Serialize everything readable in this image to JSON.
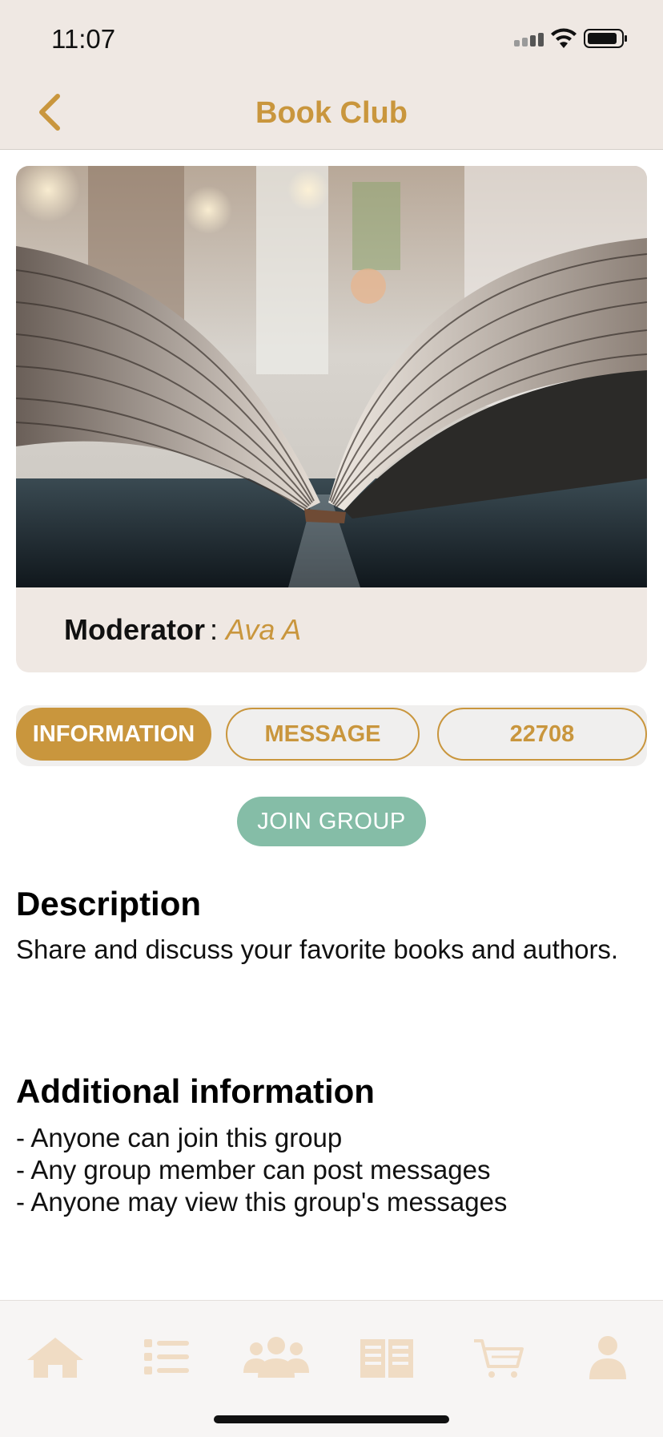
{
  "status_bar": {
    "time": "11:07"
  },
  "nav": {
    "title": "Book Club",
    "back_icon": "chevron-left-icon"
  },
  "group": {
    "moderator_label": "Moderator",
    "moderator_separator": ":",
    "moderator_name": "Ava A",
    "image": "open-book-photo"
  },
  "tabs": [
    {
      "label": "INFORMATION",
      "active": true
    },
    {
      "label": "MESSAGE",
      "active": false
    },
    {
      "label": "22708",
      "active": false
    }
  ],
  "join_button": {
    "label": "JOIN GROUP"
  },
  "description": {
    "title": "Description",
    "text": "Share and discuss your favorite books and authors."
  },
  "additional": {
    "title": "Additional information",
    "items": [
      "- Anyone can join this group",
      "- Any group member can post messages",
      "- Anyone may view this group's messages"
    ]
  },
  "bottom_nav": [
    {
      "icon": "home-icon"
    },
    {
      "icon": "list-icon"
    },
    {
      "icon": "group-icon"
    },
    {
      "icon": "book-icon"
    },
    {
      "icon": "cart-icon"
    },
    {
      "icon": "profile-icon"
    }
  ],
  "colors": {
    "accent": "#c9963d",
    "header_bg": "#efe8e3",
    "join_button": "#85bda7",
    "tab_icon": "#f0dcc4"
  }
}
